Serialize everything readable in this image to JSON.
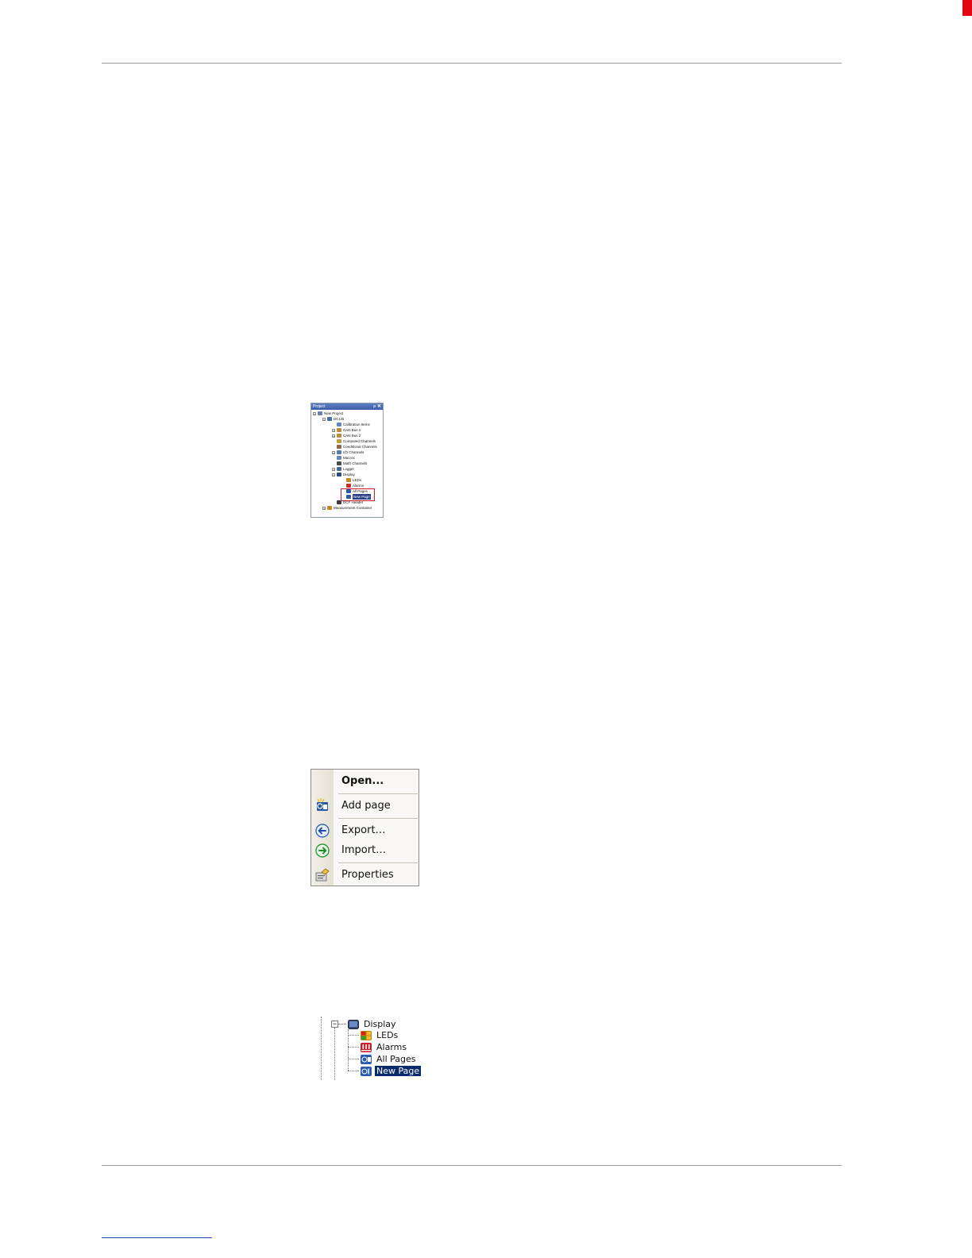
{
  "project_panel": {
    "title": "Project",
    "pin_glyph": "ᵽ",
    "close_glyph": "✕",
    "items": [
      {
        "label": "New Project",
        "icon": "project-icon",
        "color": "#6b7fa8"
      },
      {
        "label": "DC1/B",
        "icon": "device-icon",
        "color": "#4a6aa8"
      },
      {
        "label": "Calibration Items",
        "icon": "calibration-icon",
        "color": "#5f88b8"
      },
      {
        "label": "CAN Bus 1",
        "icon": "can-bus-icon",
        "color": "#b98a3a"
      },
      {
        "label": "CAN Bus 2",
        "icon": "can-bus-icon",
        "color": "#b98a3a"
      },
      {
        "label": "Computed Channels",
        "icon": "computed-icon",
        "color": "#c89a3a"
      },
      {
        "label": "Conditional Channels",
        "icon": "conditional-icon",
        "color": "#8a6a4a"
      },
      {
        "label": "I/O Channels",
        "icon": "io-icon",
        "color": "#5a78b0"
      },
      {
        "label": "Macros",
        "icon": "macro-icon",
        "color": "#6a86b8"
      },
      {
        "label": "Math Channels",
        "icon": "math-icon",
        "color": "#4a4a4a"
      },
      {
        "label": "Logger",
        "icon": "logger-icon",
        "color": "#4a6a8a"
      },
      {
        "label": "Display",
        "icon": "display-icon",
        "color": "#2a4a7a"
      },
      {
        "label": "LEDs",
        "icon": "leds-icon",
        "color": "#c8861e"
      },
      {
        "label": "Alarms",
        "icon": "alarm-icon",
        "color": "#c82a2a"
      },
      {
        "label": "All Pages",
        "icon": "pages-icon",
        "color": "#2a5aa8"
      },
      {
        "label": "New Page",
        "icon": "page-icon",
        "color": "#2a5aa8"
      },
      {
        "label": "DCF Header",
        "icon": "header-icon",
        "color": "#3a3a3a"
      },
      {
        "label": "Measurement Container",
        "icon": "container-icon",
        "color": "#c8861e"
      }
    ]
  },
  "context_menu": {
    "items": [
      {
        "label": "Open...",
        "icon": "",
        "bold": true
      },
      {
        "label": "Add page",
        "icon": "add-page-icon",
        "bold": false
      },
      {
        "label": "Export…",
        "icon": "export-arrow-icon",
        "bold": false
      },
      {
        "label": "Import…",
        "icon": "import-arrow-icon",
        "bold": false
      },
      {
        "label": "Properties",
        "icon": "properties-icon",
        "bold": false
      }
    ]
  },
  "display_tree": {
    "collapse_glyph": "−",
    "root": {
      "label": "Display",
      "icon": "display-icon"
    },
    "children": [
      {
        "label": "LEDs",
        "icon": "leds-icon"
      },
      {
        "label": "Alarms",
        "icon": "alarm-icon"
      },
      {
        "label": "All Pages",
        "icon": "pages-icon"
      },
      {
        "label": "New Page",
        "icon": "page-icon",
        "selected": true
      }
    ]
  },
  "colors": {
    "accent_red": "#e30613",
    "selection": "#0a2a6e",
    "highlight_box": "#d01a2a"
  }
}
